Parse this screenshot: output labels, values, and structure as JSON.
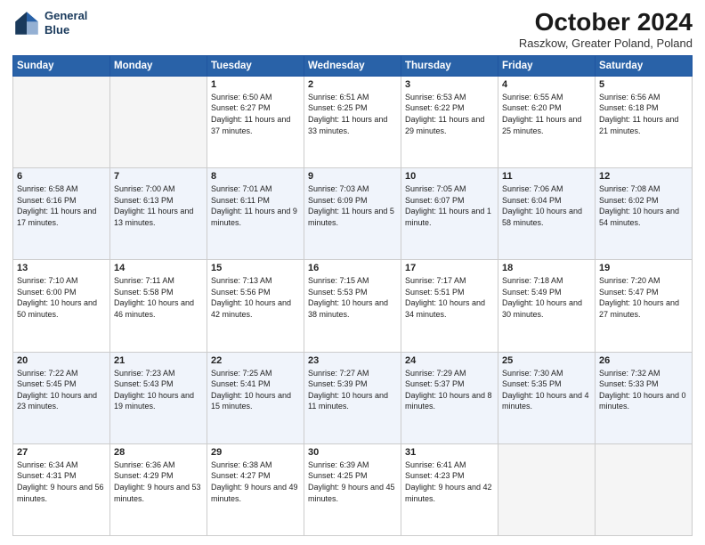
{
  "header": {
    "logo_line1": "General",
    "logo_line2": "Blue",
    "title": "October 2024",
    "subtitle": "Raszkow, Greater Poland, Poland"
  },
  "days_of_week": [
    "Sunday",
    "Monday",
    "Tuesday",
    "Wednesday",
    "Thursday",
    "Friday",
    "Saturday"
  ],
  "weeks": [
    [
      {
        "day": "",
        "text": ""
      },
      {
        "day": "",
        "text": ""
      },
      {
        "day": "1",
        "text": "Sunrise: 6:50 AM\nSunset: 6:27 PM\nDaylight: 11 hours and 37 minutes."
      },
      {
        "day": "2",
        "text": "Sunrise: 6:51 AM\nSunset: 6:25 PM\nDaylight: 11 hours and 33 minutes."
      },
      {
        "day": "3",
        "text": "Sunrise: 6:53 AM\nSunset: 6:22 PM\nDaylight: 11 hours and 29 minutes."
      },
      {
        "day": "4",
        "text": "Sunrise: 6:55 AM\nSunset: 6:20 PM\nDaylight: 11 hours and 25 minutes."
      },
      {
        "day": "5",
        "text": "Sunrise: 6:56 AM\nSunset: 6:18 PM\nDaylight: 11 hours and 21 minutes."
      }
    ],
    [
      {
        "day": "6",
        "text": "Sunrise: 6:58 AM\nSunset: 6:16 PM\nDaylight: 11 hours and 17 minutes."
      },
      {
        "day": "7",
        "text": "Sunrise: 7:00 AM\nSunset: 6:13 PM\nDaylight: 11 hours and 13 minutes."
      },
      {
        "day": "8",
        "text": "Sunrise: 7:01 AM\nSunset: 6:11 PM\nDaylight: 11 hours and 9 minutes."
      },
      {
        "day": "9",
        "text": "Sunrise: 7:03 AM\nSunset: 6:09 PM\nDaylight: 11 hours and 5 minutes."
      },
      {
        "day": "10",
        "text": "Sunrise: 7:05 AM\nSunset: 6:07 PM\nDaylight: 11 hours and 1 minute."
      },
      {
        "day": "11",
        "text": "Sunrise: 7:06 AM\nSunset: 6:04 PM\nDaylight: 10 hours and 58 minutes."
      },
      {
        "day": "12",
        "text": "Sunrise: 7:08 AM\nSunset: 6:02 PM\nDaylight: 10 hours and 54 minutes."
      }
    ],
    [
      {
        "day": "13",
        "text": "Sunrise: 7:10 AM\nSunset: 6:00 PM\nDaylight: 10 hours and 50 minutes."
      },
      {
        "day": "14",
        "text": "Sunrise: 7:11 AM\nSunset: 5:58 PM\nDaylight: 10 hours and 46 minutes."
      },
      {
        "day": "15",
        "text": "Sunrise: 7:13 AM\nSunset: 5:56 PM\nDaylight: 10 hours and 42 minutes."
      },
      {
        "day": "16",
        "text": "Sunrise: 7:15 AM\nSunset: 5:53 PM\nDaylight: 10 hours and 38 minutes."
      },
      {
        "day": "17",
        "text": "Sunrise: 7:17 AM\nSunset: 5:51 PM\nDaylight: 10 hours and 34 minutes."
      },
      {
        "day": "18",
        "text": "Sunrise: 7:18 AM\nSunset: 5:49 PM\nDaylight: 10 hours and 30 minutes."
      },
      {
        "day": "19",
        "text": "Sunrise: 7:20 AM\nSunset: 5:47 PM\nDaylight: 10 hours and 27 minutes."
      }
    ],
    [
      {
        "day": "20",
        "text": "Sunrise: 7:22 AM\nSunset: 5:45 PM\nDaylight: 10 hours and 23 minutes."
      },
      {
        "day": "21",
        "text": "Sunrise: 7:23 AM\nSunset: 5:43 PM\nDaylight: 10 hours and 19 minutes."
      },
      {
        "day": "22",
        "text": "Sunrise: 7:25 AM\nSunset: 5:41 PM\nDaylight: 10 hours and 15 minutes."
      },
      {
        "day": "23",
        "text": "Sunrise: 7:27 AM\nSunset: 5:39 PM\nDaylight: 10 hours and 11 minutes."
      },
      {
        "day": "24",
        "text": "Sunrise: 7:29 AM\nSunset: 5:37 PM\nDaylight: 10 hours and 8 minutes."
      },
      {
        "day": "25",
        "text": "Sunrise: 7:30 AM\nSunset: 5:35 PM\nDaylight: 10 hours and 4 minutes."
      },
      {
        "day": "26",
        "text": "Sunrise: 7:32 AM\nSunset: 5:33 PM\nDaylight: 10 hours and 0 minutes."
      }
    ],
    [
      {
        "day": "27",
        "text": "Sunrise: 6:34 AM\nSunset: 4:31 PM\nDaylight: 9 hours and 56 minutes."
      },
      {
        "day": "28",
        "text": "Sunrise: 6:36 AM\nSunset: 4:29 PM\nDaylight: 9 hours and 53 minutes."
      },
      {
        "day": "29",
        "text": "Sunrise: 6:38 AM\nSunset: 4:27 PM\nDaylight: 9 hours and 49 minutes."
      },
      {
        "day": "30",
        "text": "Sunrise: 6:39 AM\nSunset: 4:25 PM\nDaylight: 9 hours and 45 minutes."
      },
      {
        "day": "31",
        "text": "Sunrise: 6:41 AM\nSunset: 4:23 PM\nDaylight: 9 hours and 42 minutes."
      },
      {
        "day": "",
        "text": ""
      },
      {
        "day": "",
        "text": ""
      }
    ]
  ]
}
